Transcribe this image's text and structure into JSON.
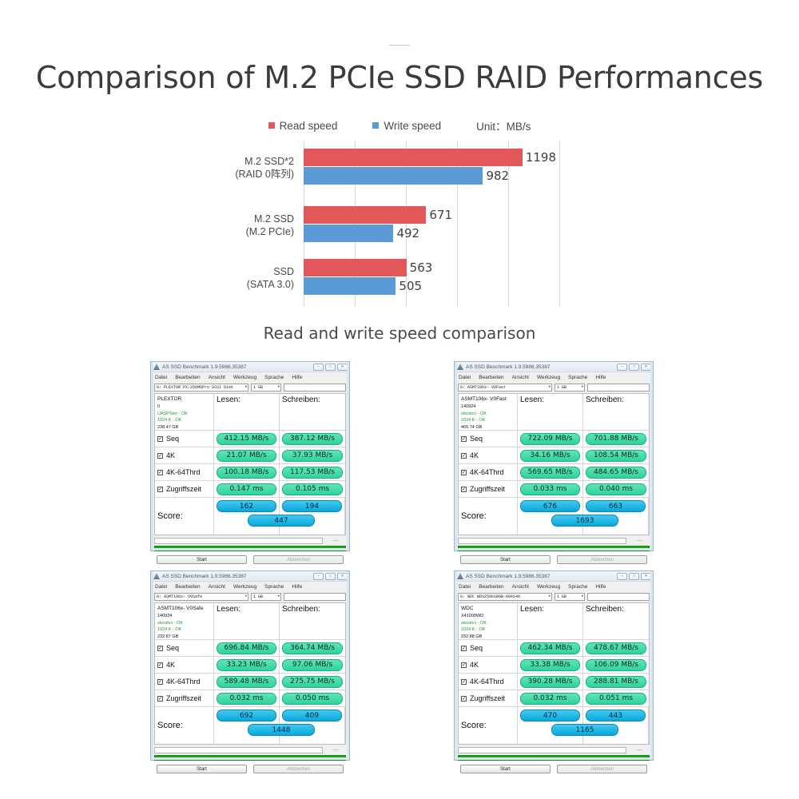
{
  "page": {
    "title": "Comparison of M.2 PCIe SSD RAID Performances",
    "caption": "Read and write speed comparison"
  },
  "legend": {
    "read_label": "Read speed",
    "write_label": "Write speed",
    "unit_label": "Unit：MB/s",
    "read_color": "#e2585a",
    "write_color": "#5b9bd5"
  },
  "chart_data": {
    "type": "bar",
    "orientation": "horizontal",
    "title": "Comparison of M.2 PCIe SSD RAID Performances",
    "subtitle": "Read and write speed comparison",
    "xlabel": "",
    "ylabel": "",
    "unit": "MB/s",
    "xlim": [
      0,
      1400
    ],
    "gridlines": [
      0,
      280,
      560,
      840,
      1120,
      1400
    ],
    "grid": true,
    "legend_position": "top-center",
    "categories": [
      {
        "line1": "M.2  SSD*2",
        "line2": "(RAID 0阵列)"
      },
      {
        "line1": "M.2 SSD",
        "line2": "(M.2 PCIe)"
      },
      {
        "line1": "SSD",
        "line2": "(SATA 3.0)"
      }
    ],
    "series": [
      {
        "name": "Read speed",
        "color": "#e2585a",
        "values": [
          1198,
          671,
          563
        ]
      },
      {
        "name": "Write speed",
        "color": "#5b9bd5",
        "values": [
          982,
          492,
          505
        ]
      }
    ]
  },
  "windows": [
    {
      "title": "AS SSD Benchmark 1.9.5986.35387",
      "menu": [
        "Datei",
        "Bearbeiten",
        "Ansicht",
        "Werkzeug",
        "Sprache",
        "Hilfe"
      ],
      "device": "G: PLEXTOR PX-256M6Pro SCSI Disk",
      "size": "1 GB",
      "textbox_value": "",
      "info": {
        "name": "PLEXTOR",
        "firmware": "0",
        "driver_ok": "UASPStor - OK",
        "align_ok": "1024 K - OK",
        "capacity": "238.47 GB"
      },
      "col_read": "Lesen:",
      "col_write": "Schreiben:",
      "rows": [
        {
          "label": "Seq",
          "read": "412.15 MB/s",
          "write": "387.12 MB/s"
        },
        {
          "label": "4K",
          "read": "21.07 MB/s",
          "write": "37.93 MB/s"
        },
        {
          "label": "4K-64Thrd",
          "read": "100.18 MB/s",
          "write": "117.53 MB/s"
        },
        {
          "label": "Zugriffszeit",
          "read": "0.147 ms",
          "write": "0.105 ms"
        }
      ],
      "score_label": "Score:",
      "score_read": "162",
      "score_write": "194",
      "score_total": "447",
      "status_tick": "–––",
      "start_button": "Start",
      "cancel_button": "Abbrechen"
    },
    {
      "title": "AS SSD Benchmark 1.9.5986.35387",
      "menu": [
        "Datei",
        "Bearbeiten",
        "Ansicht",
        "Werkzeug",
        "Sprache",
        "Hilfe"
      ],
      "device": "G: ASMT106x- V0Fast",
      "size": "1 GB",
      "textbox_value": "",
      "info": {
        "name": "ASMT106x- V0Fast",
        "firmware": "140924",
        "driver_ok": "storahci - OK",
        "align_ok": "1024 K - OK",
        "capacity": "465.74 GB"
      },
      "col_read": "Lesen:",
      "col_write": "Schreiben:",
      "rows": [
        {
          "label": "Seq",
          "read": "722.09 MB/s",
          "write": "701.88 MB/s"
        },
        {
          "label": "4K",
          "read": "34.16 MB/s",
          "write": "108.54 MB/s"
        },
        {
          "label": "4K-64Thrd",
          "read": "569.65 MB/s",
          "write": "484.65 MB/s"
        },
        {
          "label": "Zugriffszeit",
          "read": "0.033 ms",
          "write": "0.040 ms"
        }
      ],
      "score_label": "Score:",
      "score_read": "676",
      "score_write": "663",
      "score_total": "1693",
      "status_tick": "–––",
      "start_button": "Start",
      "cancel_button": "Abbrechen"
    },
    {
      "title": "AS SSD Benchmark 1.9.5986.35387",
      "menu": [
        "Datei",
        "Bearbeiten",
        "Ansicht",
        "Werkzeug",
        "Sprache",
        "Hilfe"
      ],
      "device": "G: ASMT106x- V0Safe",
      "size": "1 GB",
      "textbox_value": "",
      "info": {
        "name": "ASMT106x- V0Safe",
        "firmware": "140924",
        "driver_ok": "storahci - OK",
        "align_ok": "1024 K - OK",
        "capacity": "232.87 GB"
      },
      "col_read": "Lesen:",
      "col_write": "Schreiben:",
      "rows": [
        {
          "label": "Seq",
          "read": "696.84 MB/s",
          "write": "364.74 MB/s"
        },
        {
          "label": "4K",
          "read": "33.23 MB/s",
          "write": "97.06 MB/s"
        },
        {
          "label": "4K-64Thrd",
          "read": "589.48 MB/s",
          "write": "275.75 MB/s"
        },
        {
          "label": "Zugriffszeit",
          "read": "0.032 ms",
          "write": "0.050 ms"
        }
      ],
      "score_label": "Score:",
      "score_read": "692",
      "score_write": "409",
      "score_total": "1448",
      "status_tick": "–––",
      "start_button": "Start",
      "cancel_button": "Abbrechen"
    },
    {
      "title": "AS SSD Benchmark 1.9.5986.35387",
      "menu": [
        "Datei",
        "Bearbeiten",
        "Ansicht",
        "Werkzeug",
        "Sprache",
        "Hilfe"
      ],
      "device": "G: WDC WDS250G1B0B-00AS40",
      "size": "1 GB",
      "textbox_value": "",
      "info": {
        "name": "WDC",
        "firmware": "X41000WD",
        "driver_ok": "storahci - OK",
        "align_ok": "1024 K - OK",
        "capacity": "232.88 GB"
      },
      "col_read": "Lesen:",
      "col_write": "Schreiben:",
      "rows": [
        {
          "label": "Seq",
          "read": "462.34 MB/s",
          "write": "478.67 MB/s"
        },
        {
          "label": "4K",
          "read": "33.38 MB/s",
          "write": "106.09 MB/s"
        },
        {
          "label": "4K-64Thrd",
          "read": "390.28 MB/s",
          "write": "288.81 MB/s"
        },
        {
          "label": "Zugriffszeit",
          "read": "0.032 ms",
          "write": "0.051 ms"
        }
      ],
      "score_label": "Score:",
      "score_read": "470",
      "score_write": "443",
      "score_total": "1165",
      "status_tick": "–––",
      "start_button": "Start",
      "cancel_button": "Abbrechen"
    }
  ],
  "window_buttons": {
    "minimize": "–",
    "maximize": "□",
    "close": "✕"
  }
}
